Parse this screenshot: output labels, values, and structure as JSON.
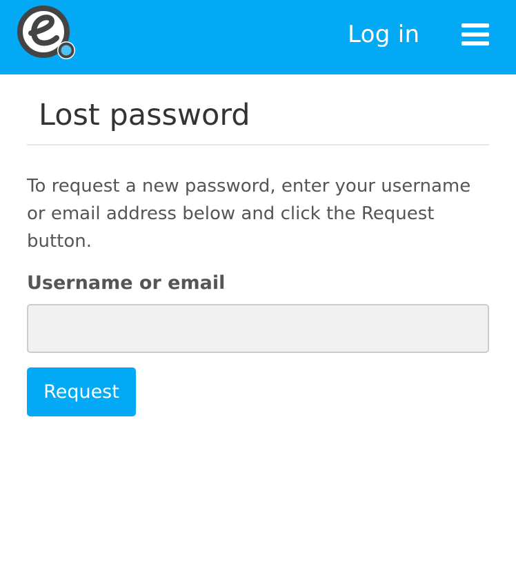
{
  "header": {
    "logo_icon": "e-logo-icon",
    "login_label": "Log in",
    "menu_icon": "hamburger-menu-icon",
    "brand_color": "#03a9f4"
  },
  "main": {
    "title": "Lost password",
    "instructions": "To request a new password, enter your username or email address below and click the Request button.",
    "field_label": "Username or email",
    "field_value": "",
    "field_placeholder": "",
    "request_label": "Request"
  }
}
